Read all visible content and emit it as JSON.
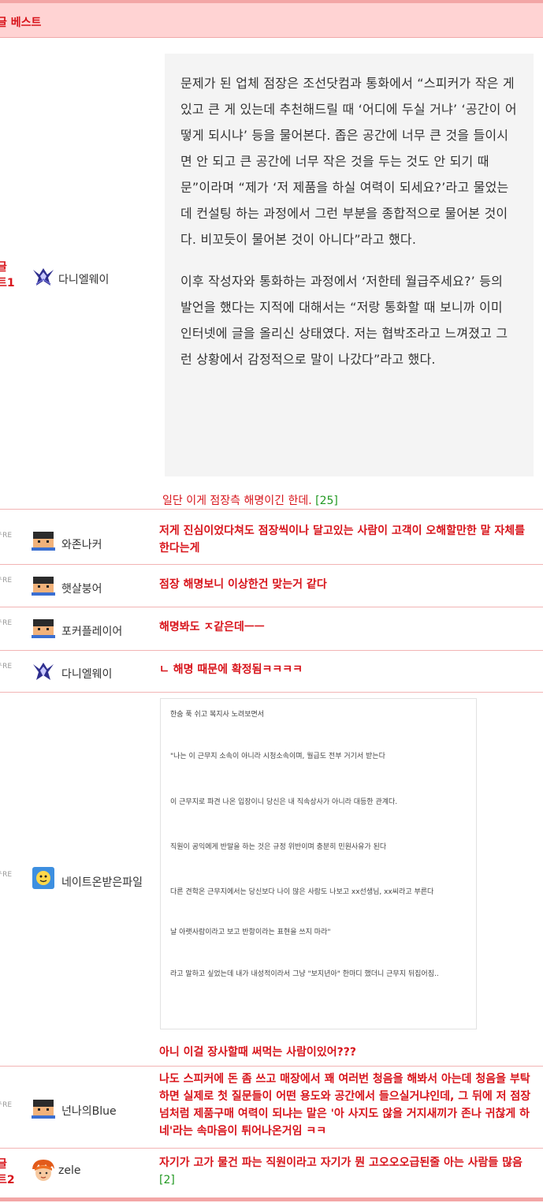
{
  "header": {
    "title": "글 베스트"
  },
  "post": {
    "best_label_1": "글",
    "best_label_2": "트1",
    "author": "다니엘웨이",
    "article_paragraphs": [
      "문제가 된 업체 점장은 조선닷컴과 통화에서 “스피커가 작은 게 있고 큰 게 있는데 추천해드릴 때 ‘어디에 두실 거냐’ ‘공간이 어떻게 되시냐’ 등을 물어본다. 좁은 공간에 너무 큰 것을 들이시면 안 되고 큰 공간에 너무 작은 것을 두는 것도 안 되기 때문”이라며 “제가 ‘저 제품을 하실 여력이 되세요?’라고 물었는데 컨설팅 하는 과정에서 그런 부분을 종합적으로 물어본 것이다. 비꼬듯이 물어본 것이 아니다”라고 했다.",
      "이후 작성자와 통화하는 과정에서 ‘저한테 월급주세요?’ 등의 발언을 했다는 지적에 대해서는 “저랑 통화할 때 보니까 이미 인터넷에 글을 올리신 상태였다. 저는 협박조라고 느껴졌고 그런 상황에서 감정적으로 말이 나갔다”라고 했다."
    ],
    "caption": "일단 이게 점장측 해명이긴 한데.",
    "caption_count": "[25]"
  },
  "replies": [
    {
      "re": "ᴸRE",
      "nick": "와존나커",
      "text": "저게 진심이었다쳐도 점장씩이나 달고있는 사람이 고객이 오해할만한 말 자체를 한다는게"
    },
    {
      "re": "ᴸRE",
      "nick": "햇살붕어",
      "text": "점장 해명보니 이상한건 맞는거 같다"
    },
    {
      "re": "ᴸRE",
      "nick": "포커플레이어",
      "text": "해명봐도 ㅈ같은데ㅡㅡ"
    },
    {
      "re": "ᴸRE",
      "nick": "다니엘웨이",
      "text": "ㄴ 해명 때문에 확정됨ㅋㅋㅋㅋ"
    },
    {
      "re": "ᴸRE",
      "nick": "네이트온받은파일",
      "quote_lines": [
        "한숨 푹 쉬고 복지사 노려보면서",
        "\"나는 이 근무지 소속이 아니라 시청소속이며, 월급도 전부 거기서 받는다",
        "이 근무지로 파견 나온 입장이니 당신은 내 직속상사가 아니라 대등한 관계다.",
        "직원이 공익에게 반말을 하는 것은 규정 위반이며 충분히 민원사유가 된다",
        "다른 견학온 근무지에서는 당신보다 나이 많은 사람도 나보고 xx선생님, xx씨라고 부른다",
        "날 아랫사람이라고 보고 반항이라는 표현을 쓰지 마라\"",
        "라고 말하고 싶었는데 내가 내성적이라서 그냥 \"보지년아\" 한마디 했더니 근무지 뒤집어짐.."
      ],
      "text": "아니 이걸 장사할때 써먹는 사람이있어???"
    },
    {
      "re": "ᴸRE",
      "nick": "넌나의Blue",
      "text": "나도 스피커에 돈 좀 쓰고 매장에서 꽤 여러번 청음을 해봐서 아는데 청음을 부탁하면 실제로 첫 질문들이 어떤 용도와 공간에서 들으실거냐인데, 그 뒤에 저 점장넘처럼 제품구매 여력이 되냐는 말은 '아 사지도 않을 거지새끼가 존나 귀찮게 하네'라는 속마음이 튀어나온거임 ㅋㅋ"
    }
  ],
  "best2": {
    "best_label_1": "글",
    "best_label_2": "트2",
    "nick": "zele",
    "text": "자기가 고가 물건 파는 직원이라고 자기가 뭔 고오오오급된줄 아는 사람들 많음",
    "count": "[2]"
  },
  "colors": {
    "accent": "#d8141b",
    "header_bg": "#ffd3d3",
    "border": "#f2b4b4",
    "count": "#229922"
  }
}
